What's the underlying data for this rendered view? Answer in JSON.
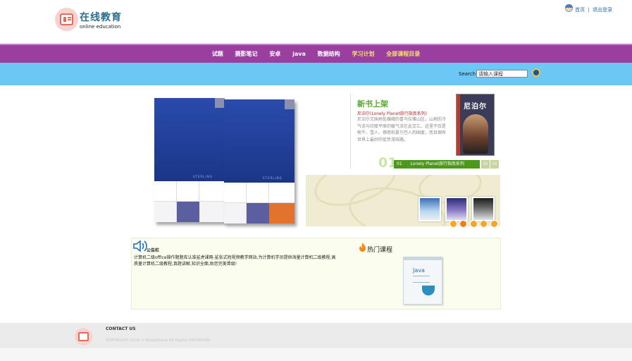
{
  "brand": {
    "title": "在线教育",
    "subtitle": "online education"
  },
  "top_links": {
    "home": "首页",
    "separator": "|",
    "logout": "退出登录"
  },
  "nav": {
    "items": [
      {
        "label": "试题",
        "highlighted": false
      },
      {
        "label": "摄影笔记",
        "highlighted": false
      },
      {
        "label": "安卓",
        "highlighted": false
      },
      {
        "label": "java",
        "highlighted": false
      },
      {
        "label": "数据结构",
        "highlighted": false
      },
      {
        "label": "学习计划",
        "highlighted": true
      },
      {
        "label": "全部课程目录",
        "highlighted": true
      }
    ],
    "highlight_color": "#f5e262",
    "bg_color": "#9a3fa0"
  },
  "search": {
    "label": "Search",
    "value": "请输入课程"
  },
  "feature": {
    "book_brand": "STERLING",
    "title": "新书上架",
    "book_name": "尼泊尔(Lonely Planet旅行指南系列)",
    "description": "尼泊尔王国地处巍峨的喜马拉雅山区，山地的冷气流与印度平原的暖气流在此交汇。这里不仅是牦牛、雪人、佛塔和夏尔巴人的国度，而且拥有世界上最好的徒步游线路。",
    "cover_title": "尼泊尔",
    "slide_number": "01",
    "tabs": [
      {
        "num": "01",
        "label": "Lonely Planet旅行指南系列"
      },
      {
        "num": "02",
        "label": ""
      },
      {
        "num": "03",
        "label": ""
      }
    ],
    "dots": [
      "1",
      "2",
      "3",
      "4",
      "5"
    ]
  },
  "notice": {
    "title": "公告栏",
    "text": "计算机二级office操作题题库认准鲨虎课网-鲨张式短视频教学网站,为计算机学员提供海量计算机二级教程,高质量计算机二级教程,真题讲解,知识全面,助您完美晋级!"
  },
  "hot": {
    "title": "热门课程",
    "book_label": "Java"
  },
  "footer": {
    "contact": "CONTACT US",
    "copyright": "COPYRIGHT 2016 © NcastStore All Rights RESERVED."
  }
}
